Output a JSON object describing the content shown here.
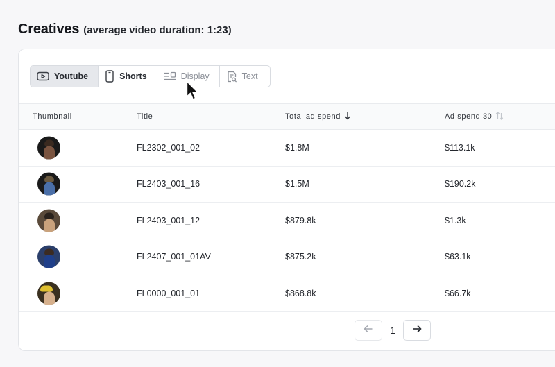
{
  "header": {
    "title": "Creatives",
    "subtitle": "(average video duration: 1:23)"
  },
  "filters": [
    {
      "label": "Youtube",
      "icon": "play-icon",
      "state": "active"
    },
    {
      "label": "Shorts",
      "icon": "phone-icon",
      "state": "normal"
    },
    {
      "label": "Display",
      "icon": "display-layout-icon",
      "state": "muted"
    },
    {
      "label": "Text",
      "icon": "text-doc-icon",
      "state": "muted"
    }
  ],
  "table": {
    "columns": {
      "thumbnail": "Thumbnail",
      "title": "Title",
      "total_ad_spend": "Total ad spend",
      "ad_spend_30": "Ad spend 30"
    },
    "rows": [
      {
        "title": "FL2302_001_02",
        "total": "$1.8M",
        "spend30": "$113.1k"
      },
      {
        "title": "FL2403_001_16",
        "total": "$1.5M",
        "spend30": "$190.2k"
      },
      {
        "title": "FL2403_001_12",
        "total": "$879.8k",
        "spend30": "$1.3k"
      },
      {
        "title": "FL2407_001_01AV",
        "total": "$875.2k",
        "spend30": "$63.1k"
      },
      {
        "title": "FL0000_001_01",
        "total": "$868.8k",
        "spend30": "$66.7k"
      }
    ]
  },
  "pagination": {
    "current_page": "1"
  },
  "colors": {
    "active_segment": "#e6e8ec",
    "border": "#d9dce1"
  }
}
